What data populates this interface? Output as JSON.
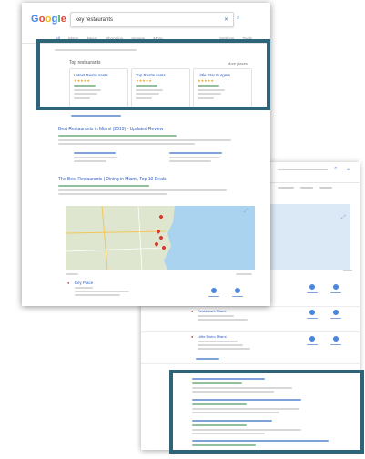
{
  "front": {
    "logo": "Google",
    "logo_colors": [
      "#4285f4",
      "#ea4335",
      "#fbbc05",
      "#4285f4",
      "#34a853",
      "#ea4335"
    ],
    "search_value": "key restaurants",
    "tabs": [
      "All",
      "Maps",
      "News",
      "Shopping",
      "Images",
      "More"
    ],
    "right_tabs": [
      "Settings",
      "Tools"
    ],
    "local_pack_title": "Top restaurants",
    "more_label": "More places",
    "cards": [
      {
        "title": "Latest Restaurants",
        "stars": "★★★★★"
      },
      {
        "title": "Top Restaurants",
        "stars": "★★★★★"
      },
      {
        "title": "Little Star Burgers",
        "stars": "★★★★★"
      }
    ],
    "organic_title_1": "Best Restaurants in Miami (2019) - Updated Review",
    "organic_title_2": "The Best Restaurants | Dining in Miami, Top 10 Deals",
    "map_item_title": "Key Place"
  },
  "back": {
    "item_1": "Restaurant Miami",
    "item_2": "Little Bistro Miami"
  },
  "highlight_color": "#2d6477"
}
